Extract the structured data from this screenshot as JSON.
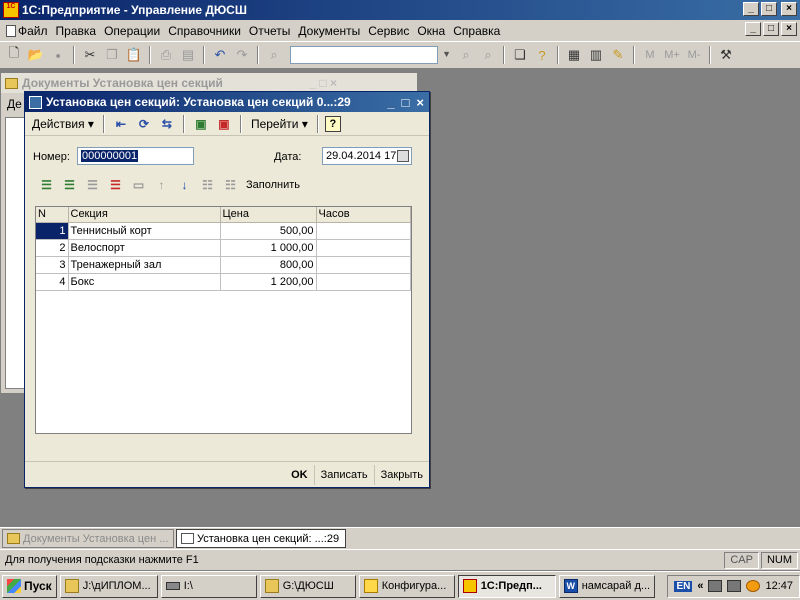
{
  "app": {
    "title": "1С:Предприятие - Управление ДЮСШ",
    "logo_text": "1C"
  },
  "menubar": {
    "items": [
      "Файл",
      "Правка",
      "Операции",
      "Справочники",
      "Отчеты",
      "Документы",
      "Сервис",
      "Окна",
      "Справка"
    ]
  },
  "window_buttons": {
    "minimize": "_",
    "maximize": "□",
    "close": "×"
  },
  "toolbar": {
    "buttons": [
      "new-document-icon",
      "open-icon",
      "save-icon",
      "cut-icon",
      "copy-icon",
      "paste-icon",
      "print-icon",
      "print-preview-icon",
      "undo-icon",
      "redo-icon",
      "find-icon",
      "search-icon",
      "search-next-icon",
      "windows-icon",
      "help-icon",
      "calculator-icon",
      "calendar-icon",
      "clipboard-icon",
      "settings-icon"
    ],
    "memory_buttons": [
      "M",
      "M+",
      "M-"
    ],
    "search_value": ""
  },
  "background_window": {
    "title": "Документы Установка цен секций",
    "truncated_label": "Де"
  },
  "dialog": {
    "title": "Установка цен секций: Установка цен секций 0...:29",
    "actions_label": "Действия",
    "goto_label": "Перейти",
    "help_label": "?",
    "number_label": "Номер:",
    "number_value": "000000001",
    "date_label": "Дата:",
    "date_value": "29.04.2014 17",
    "fill_label": "Заполнить",
    "table": {
      "columns": [
        "N",
        "Секция",
        "Цена",
        "Часов"
      ],
      "rows": [
        {
          "n": "1",
          "section": "Теннисный корт",
          "price": "500,00",
          "hours": ""
        },
        {
          "n": "2",
          "section": "Велоспорт",
          "price": "1 000,00",
          "hours": ""
        },
        {
          "n": "3",
          "section": "Тренажерный зал",
          "price": "800,00",
          "hours": ""
        },
        {
          "n": "4",
          "section": "Бокс",
          "price": "1 200,00",
          "hours": ""
        }
      ]
    },
    "footer": {
      "ok": "OK",
      "save": "Записать",
      "close": "Закрыть"
    }
  },
  "window_tabs": [
    {
      "label": "Документы Установка цен ...",
      "active": false
    },
    {
      "label": "Установка цен секций: ...:29",
      "active": true
    }
  ],
  "statusbar": {
    "hint": "Для получения подсказки нажмите F1",
    "cap": "CAP",
    "num": "NUM"
  },
  "taskbar": {
    "start": "Пуск",
    "buttons": [
      {
        "label": "J:\\дИПЛОМ...",
        "icon": "folder-icon"
      },
      {
        "label": "I:\\",
        "icon": "drive-icon"
      },
      {
        "label": "G:\\ДЮСШ",
        "icon": "folder-icon"
      },
      {
        "label": "Конфигура...",
        "icon": "config-icon"
      },
      {
        "label": "1С:Предп...",
        "icon": "1c-icon",
        "active": true
      },
      {
        "label": "намсарай д...",
        "icon": "word-icon"
      }
    ],
    "lang": "EN",
    "tray_chevron": "«",
    "clock": "12:47"
  }
}
